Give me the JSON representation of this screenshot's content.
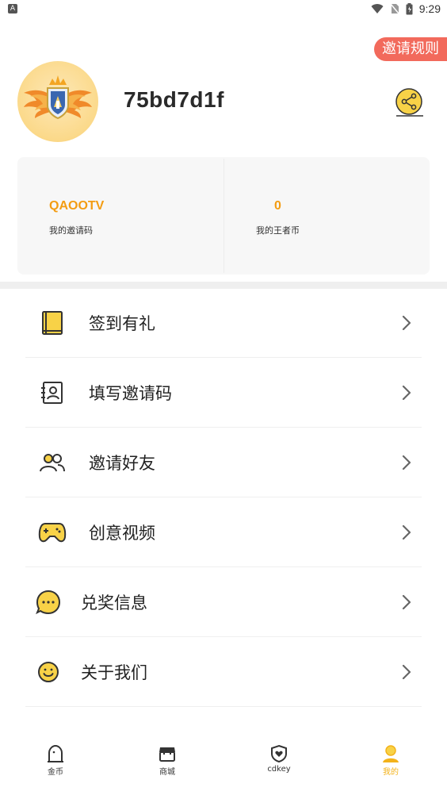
{
  "status_bar": {
    "left_icon_text": "A",
    "time": "9:29"
  },
  "header": {
    "invite_rules_label": "邀请规则",
    "username": "75bd7d1f",
    "share_icon": "share-icon",
    "avatar_icon": "winged-shield-emblem"
  },
  "stats": {
    "invite_code_value": "QAOOTV",
    "invite_code_label": "我的邀请码",
    "coins_value": "0",
    "coins_label": "我的王者币"
  },
  "menu": {
    "items": [
      {
        "label": "签到有礼",
        "icon": "book-icon"
      },
      {
        "label": "填写邀请码",
        "icon": "contact-card-icon"
      },
      {
        "label": "邀请好友",
        "icon": "users-icon"
      },
      {
        "label": "创意视频",
        "icon": "gamepad-icon"
      },
      {
        "label": "兑奖信息",
        "icon": "chat-bubble-icon"
      },
      {
        "label": "关于我们",
        "icon": "smiley-icon"
      }
    ]
  },
  "tab_bar": {
    "tabs": [
      {
        "label": "金币",
        "icon": "tombstone-icon",
        "active": false
      },
      {
        "label": "商城",
        "icon": "store-icon",
        "active": false
      },
      {
        "label": "cdkey",
        "icon": "shield-heart-icon",
        "active": false
      },
      {
        "label": "我的",
        "icon": "user-icon",
        "active": true
      }
    ]
  },
  "colors": {
    "accent": "#f39c12",
    "invite_rules_bg": "#f26a5c",
    "active_tab": "#f3b21a",
    "icon_yellow": "#f8d247"
  }
}
